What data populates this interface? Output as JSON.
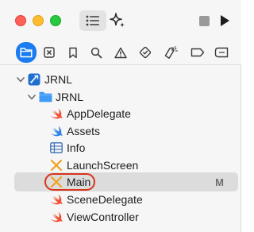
{
  "window": {
    "toolbar": {
      "sidebar_toggle_icon": "sidebar-list-icon",
      "ai_icon": "sparkle-icon",
      "stop_icon": "stop-icon",
      "run_icon": "play-icon"
    },
    "navigator_tabs": [
      {
        "icon": "folder-icon",
        "active": true
      },
      {
        "icon": "source-control-icon",
        "active": false
      },
      {
        "icon": "bookmark-icon",
        "active": false
      },
      {
        "icon": "magnifier-icon",
        "active": false
      },
      {
        "icon": "warning-icon",
        "active": false
      },
      {
        "icon": "test-diamond-icon",
        "active": false
      },
      {
        "icon": "debug-tag-icon",
        "active": false
      },
      {
        "icon": "breakpoint-icon",
        "active": false
      },
      {
        "icon": "report-icon",
        "active": false
      }
    ],
    "tree": {
      "project": {
        "label": "JRNL",
        "icon": "xcode-project-icon"
      },
      "group": {
        "label": "JRNL",
        "icon": "blue-folder-icon"
      },
      "files": [
        {
          "label": "AppDelegate",
          "icon": "swift-icon",
          "badge": ""
        },
        {
          "label": "Assets",
          "icon": "asset-catalog-icon",
          "badge": ""
        },
        {
          "label": "Info",
          "icon": "plist-icon",
          "badge": ""
        },
        {
          "label": "LaunchScreen",
          "icon": "storyboard-icon",
          "badge": ""
        },
        {
          "label": "Main",
          "icon": "storyboard-icon",
          "badge": "M",
          "selected": true
        },
        {
          "label": "SceneDelegate",
          "icon": "swift-icon",
          "badge": ""
        },
        {
          "label": "ViewController",
          "icon": "swift-icon",
          "badge": ""
        }
      ]
    },
    "colors": {
      "accent": "#1a7cf0",
      "selection": "#dcdcdc",
      "highlight_ring": "#d9331c",
      "swift": "#f05138",
      "storyboard": "#f0a020"
    }
  }
}
